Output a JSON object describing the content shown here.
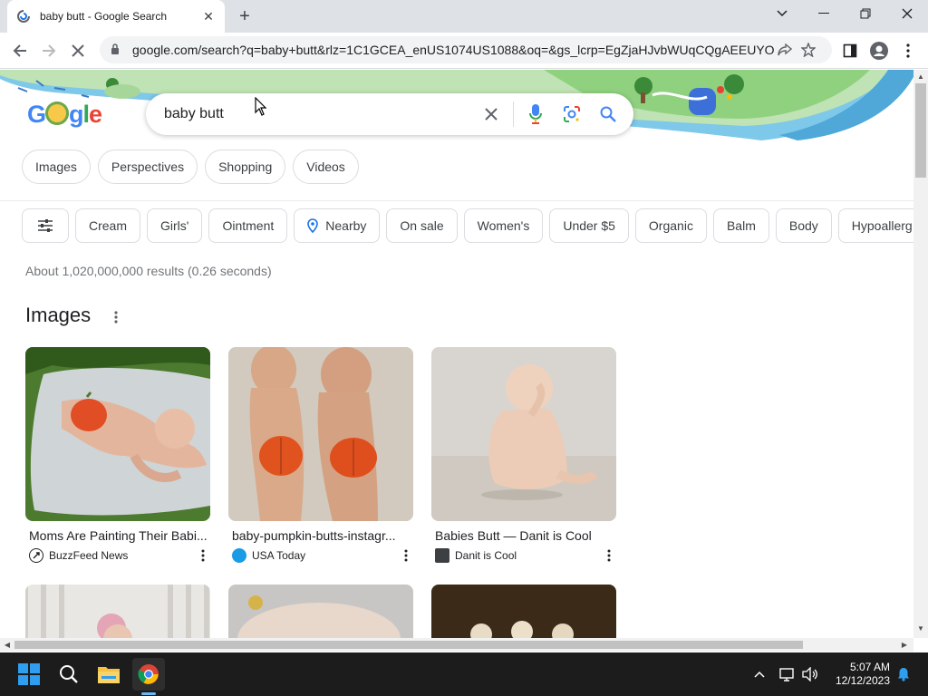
{
  "browser": {
    "tab_title": "baby butt - Google Search",
    "url": "google.com/search?q=baby+butt&rlz=1C1GCEA_enUS1074US1088&oq=&gs_lcrp=EgZjaHJvbWUqCQgAEEUYO..."
  },
  "search": {
    "logo": "Google",
    "query": "baby butt"
  },
  "tabs": [
    {
      "label": "Images"
    },
    {
      "label": "Perspectives"
    },
    {
      "label": "Shopping"
    },
    {
      "label": "Videos"
    }
  ],
  "chips": [
    {
      "label": "Cream"
    },
    {
      "label": "Girls'"
    },
    {
      "label": "Ointment"
    },
    {
      "label": "Nearby"
    },
    {
      "label": "On sale"
    },
    {
      "label": "Women's"
    },
    {
      "label": "Under $5"
    },
    {
      "label": "Organic"
    },
    {
      "label": "Balm"
    },
    {
      "label": "Body"
    },
    {
      "label": "Hypoallerg"
    }
  ],
  "results_stats": "About 1,020,000,000 results (0.26 seconds)",
  "images_section": {
    "heading": "Images",
    "cards": [
      {
        "caption": "Moms Are Painting Their Babi...",
        "source": "BuzzFeed News",
        "source_color": "#202124"
      },
      {
        "caption": "baby-pumpkin-butts-instagr...",
        "source": "USA Today",
        "source_color": "#1a73e8"
      },
      {
        "caption": "Babies Butt — Danit is Cool",
        "source": "Danit is Cool",
        "source_color": "#3c4043"
      }
    ]
  },
  "taskbar": {
    "time": "5:07 AM",
    "date": "12/12/2023"
  },
  "colors": {
    "accent": "#1a73e8",
    "chrome_tabstrip": "#dee1e6",
    "taskbar": "#1c1c1c"
  }
}
